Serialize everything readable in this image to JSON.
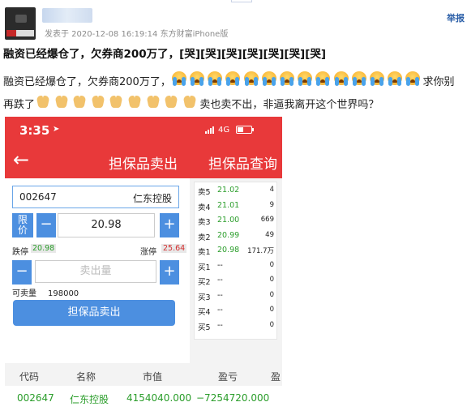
{
  "post": {
    "meta": "发表于 2020-12-08 16:19:14 东方财富iPhone版",
    "report": "举报",
    "title": "融资已经爆仓了，欠券商200万了，[哭][哭][哭][哭][哭][哭][哭]",
    "body_line1_prefix": "融资已经爆仓了，欠券商200万了，",
    "body_line1_suffix": "求你别",
    "body_line2_prefix": "再跌了",
    "body_line2_suffix": "卖也卖不出，非逼我离开这个世界吗？",
    "crying_emoji_count": 14,
    "pray_emoji_count": 9
  },
  "phone": {
    "status": {
      "time": "3:35",
      "network": "4G"
    },
    "nav": {
      "back": "←",
      "title": "担保品卖出",
      "right": "担保品查询"
    },
    "stock": {
      "code": "002647",
      "name": "仁东控股"
    },
    "price_type": "限价",
    "price": "20.98",
    "minus": "−",
    "plus": "+",
    "limit_down_label": "跌停",
    "limit_down": "20.98",
    "limit_up_label": "涨停",
    "limit_up": "25.64",
    "qty_placeholder": "卖出量",
    "available_label": "可卖量",
    "available": "198000",
    "sell_button": "担保品卖出",
    "orderbook": [
      {
        "label": "卖5",
        "price": "21.02",
        "vol": "4"
      },
      {
        "label": "卖4",
        "price": "21.01",
        "vol": "9"
      },
      {
        "label": "卖3",
        "price": "21.00",
        "vol": "669"
      },
      {
        "label": "卖2",
        "price": "20.99",
        "vol": "49"
      },
      {
        "label": "卖1",
        "price": "20.98",
        "vol": "171.7万"
      },
      {
        "label": "买1",
        "price": "--",
        "vol": "0"
      },
      {
        "label": "买2",
        "price": "--",
        "vol": "0"
      },
      {
        "label": "买3",
        "price": "--",
        "vol": "0"
      },
      {
        "label": "买4",
        "price": "--",
        "vol": "0"
      },
      {
        "label": "买5",
        "price": "--",
        "vol": "0"
      }
    ],
    "table": {
      "headers": [
        "代码",
        "名称",
        "市值",
        "盈亏",
        "盈"
      ],
      "row": [
        "002647",
        "仁东控股",
        "4154040.000",
        "−7254720.000",
        ""
      ]
    }
  }
}
